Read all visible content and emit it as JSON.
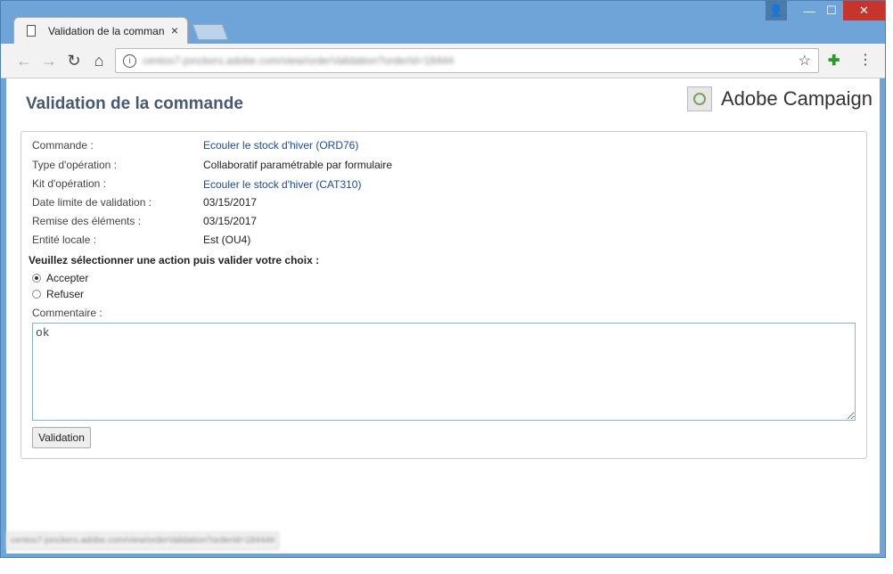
{
  "browser": {
    "tab_title": "Validation de la commande",
    "tab_close": "×",
    "url": "centos7-jonckers.adobe.com/view/orderValidation?orderId=18444",
    "status_url": "centos7-jonckers.adobe.com/view/orderValidation?orderId=18444#",
    "icons": [
      "back-icon",
      "forward-icon",
      "reload-icon",
      "home-icon",
      "info-icon",
      "star-icon",
      "extension-icon",
      "menu-icon"
    ]
  },
  "page": {
    "title": "Validation de la commande",
    "brand": "Adobe Campaign",
    "fields": [
      {
        "label": "Commande :",
        "value": "Ecouler le stock d'hiver (ORD76)"
      },
      {
        "label": "Type d'opération :",
        "value": "Collaboratif paramétrable par formulaire"
      },
      {
        "label": "Kit d'opération :",
        "value": "Ecouler le stock d'hiver (CAT310)"
      },
      {
        "label": "Date limite de validation :",
        "value": "03/15/2017"
      },
      {
        "label": "Remise des éléments :",
        "value": "03/15/2017"
      },
      {
        "label": "Entité locale :",
        "value": "Est (OU4)"
      }
    ],
    "prompt": "Veuillez sélectionner une action puis valider votre choix :",
    "options": [
      {
        "label": "Accepter",
        "selected": true
      },
      {
        "label": "Refuser",
        "selected": false
      }
    ],
    "comment_label": "Commentaire :",
    "comment_value": "ok",
    "submit_label": "Validation"
  },
  "colors": {
    "link": "#1a4a9a",
    "title": "#4a5a6e",
    "window": "#6ea4d8",
    "close": "#c7342c"
  }
}
